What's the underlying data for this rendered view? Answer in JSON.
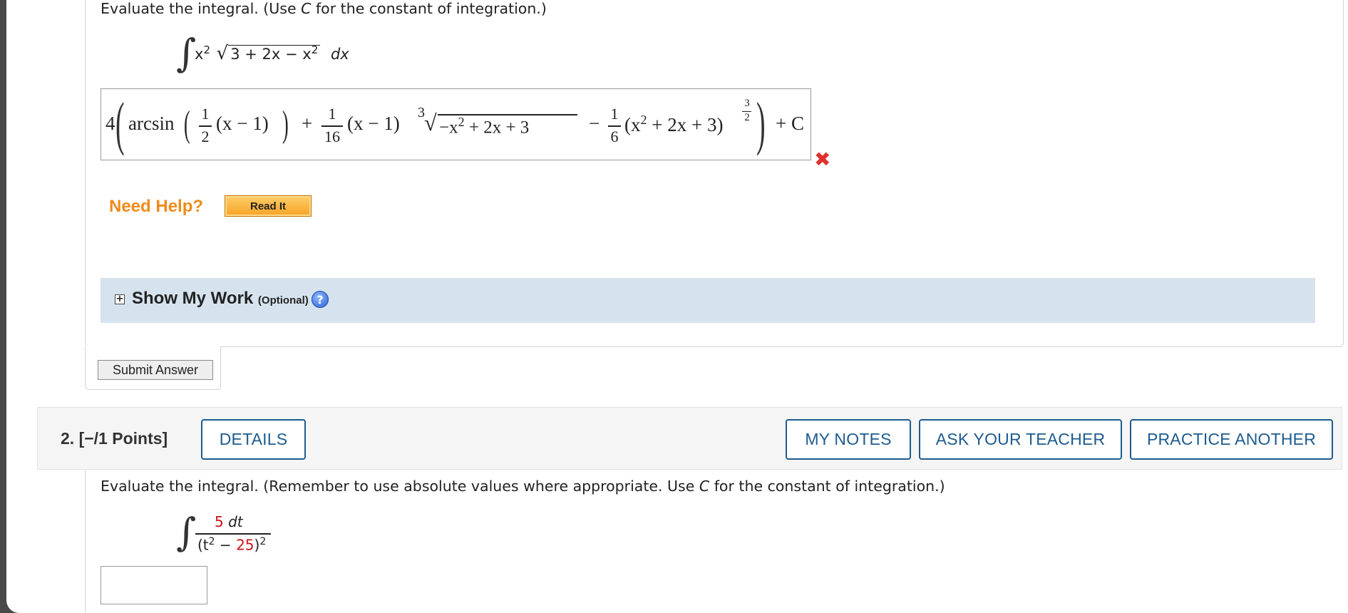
{
  "q1": {
    "prompt_before": "Evaluate the integral. (Use ",
    "prompt_var": "C",
    "prompt_after": " for the constant of integration.)",
    "integrand": {
      "x": "x",
      "x_exp": "2",
      "radicand": "3 + 2x − x",
      "radicand_exp": "2",
      "dx": "dx"
    },
    "answer": {
      "lead": "4",
      "arcsin": "arcsin",
      "half_num": "1",
      "half_den": "2",
      "term1": "(x − 1)",
      "plus1": "+",
      "frac16_num": "1",
      "frac16_den": "16",
      "term2": "(x − 1)",
      "term2_exp": "3",
      "radicand": "−x",
      "radicand_exp": "2",
      "radicand_rest": " + 2x + 3",
      "minus": "−",
      "frac6_num": "1",
      "frac6_den": "6",
      "term3_open": "(x",
      "term3_exp": "2",
      "term3_rest": " + 2x + 3)",
      "pow_num": "3",
      "pow_den": "2",
      "plus_c": "+ C"
    },
    "status": "incorrect"
  },
  "help": {
    "label": "Need Help?",
    "read_it": "Read It"
  },
  "show_my_work": {
    "title": "Show My Work",
    "optional": "(Optional)",
    "help_glyph": "?"
  },
  "submit_label": "Submit Answer",
  "q2": {
    "label": "2.  [−/1 Points]",
    "details": "DETAILS",
    "my_notes": "MY NOTES",
    "ask_teacher": "ASK YOUR TEACHER",
    "practice": "PRACTICE ANOTHER",
    "prompt_before": "Evaluate the integral. (Remember to use absolute values where appropriate. Use ",
    "prompt_var": "C",
    "prompt_after": " for the constant of integration.)",
    "numerator_coef": "5",
    "numerator_var": " dt",
    "den_open": "(t",
    "den_exp": "2",
    "den_minus": " − ",
    "den_const": "25",
    "den_close": ")",
    "den_outer_exp": "2",
    "answer_value": ""
  },
  "colors": {
    "accent": "#1d5b8f",
    "help_orange": "#f08a1a",
    "wrong_red": "#e0312f",
    "panel_blue": "#d6e3ee"
  }
}
